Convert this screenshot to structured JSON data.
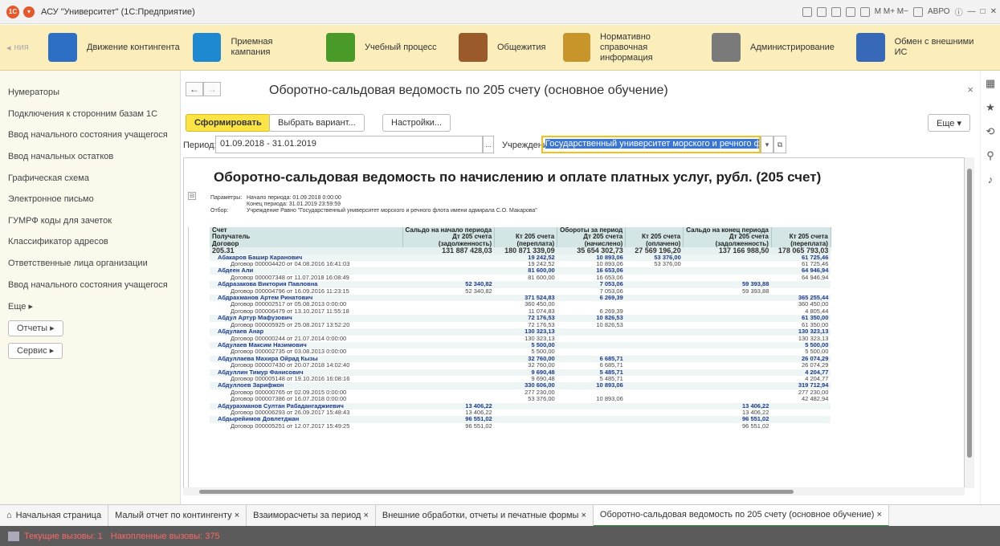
{
  "window": {
    "title": "АСУ \"Университет\" (1С:Предприятие)",
    "user": "АВРО"
  },
  "sections": [
    {
      "label": "ния",
      "color": "#3a6bd0"
    },
    {
      "label": "Движение контингента",
      "color": "#2d6fc4"
    },
    {
      "label": "Приемная кампания",
      "color": "#1e88d0"
    },
    {
      "label": "Учебный процесс",
      "color": "#4a9a2a"
    },
    {
      "label": "Общежития",
      "color": "#9b5a2a"
    },
    {
      "label": "Нормативно справочная информация",
      "color": "#c8952a"
    },
    {
      "label": "Администрирование",
      "color": "#7a7a7a"
    },
    {
      "label": "Обмен с внешними ИС",
      "color": "#3868b8"
    }
  ],
  "sidebar": {
    "items": [
      "Нумераторы",
      "Подключения к сторонним базам 1С",
      "Ввод начального состояния учащегося",
      "Ввод начальных остатков",
      "Графическая схема",
      "Электронное письмо",
      "ГУМРФ коды для зачеток",
      "Классификатор адресов",
      "Ответственные лица организации",
      "Ввод начального состояния учащегося",
      "Еще ▸"
    ],
    "reports_btn": "Отчеты ▸",
    "service_btn": "Сервис ▸"
  },
  "form": {
    "title": "Оборотно-сальдовая ведомость по 205 счету (основное обучение)",
    "btn_generate": "Сформировать",
    "btn_variant": "Выбрать вариант...",
    "btn_settings": "Настройки...",
    "btn_more": "Еще ▾",
    "period_label": "Период:",
    "period_value": "01.09.2018 - 31.01.2019",
    "org_label": "Учреждение:",
    "org_value": "Государственный университет морского и речного флота им"
  },
  "report": {
    "title": "Оборотно-сальдовая ведомость по начислению и оплате платных услуг, рубл. (205 счет)",
    "params_label": "Параметры:",
    "param1": "Начало периода: 01.09.2018 0:00:00",
    "param2": "Конец периода: 31.01.2019 23:59:59",
    "filter_label": "Отбор:",
    "filter_value": "Учреждение Равно \"Государственный университет морского и речного флота имени адмирала С.О. Макарова\"",
    "headers": [
      [
        "Счет",
        "Сальдо на начало периода",
        "",
        "Обороты за период",
        "",
        "Сальдо на конец периода",
        ""
      ],
      [
        "Получатель",
        "Дт 205 счета",
        "Кт 205 счета",
        "Дт 205 счета",
        "Кт 205 счета",
        "Дт 205 счета",
        "Кт 205 счета"
      ],
      [
        "Договор",
        "(задолженность)",
        "(переплата)",
        "(начислено)",
        "(оплачено)",
        "(задолженность)",
        "(переплата)"
      ]
    ],
    "total": [
      "205.31",
      "131 887 428,03",
      "180 871 339,09",
      "35 654 302,73",
      "27 569 196,20",
      "137 166 988,50",
      "178 065 793,03"
    ],
    "rows": [
      [
        "p",
        "Абакаров Башир Каранович",
        "",
        "19 242,52",
        "10 893,06",
        "53 376,00",
        "",
        "61 725,46"
      ],
      [
        "d",
        "Договор 000004420 от 04.08.2016 16:41:03",
        "",
        "19 242,52",
        "10 893,06",
        "53 376,00",
        "",
        "61 725,46"
      ],
      [
        "p",
        "Абдеен Али",
        "",
        "81 600,00",
        "16 653,06",
        "",
        "",
        "64 946,94"
      ],
      [
        "d",
        "Договор 000007348 от 11.07.2018 16:08:49",
        "",
        "81 600,00",
        "16 653,06",
        "",
        "",
        "64 946,94"
      ],
      [
        "p",
        "Абдразакова Виктория Павловна",
        "52 340,82",
        "",
        "7 053,06",
        "",
        "59 393,88",
        ""
      ],
      [
        "d",
        "Договор 000004796 от 16.09.2016 11:23:15",
        "52 340,82",
        "",
        "7 053,06",
        "",
        "59 393,88",
        ""
      ],
      [
        "p",
        "Абдрахманов Артем Ринатович",
        "",
        "371 524,83",
        "6 269,39",
        "",
        "",
        "365 255,44"
      ],
      [
        "d",
        "Договор 000002517 от 05.08.2013 0:00:00",
        "",
        "360 450,00",
        "",
        "",
        "",
        "360 450,00"
      ],
      [
        "d",
        "Договор 000006479 от 13.10.2017 11:55:18",
        "",
        "11 074,83",
        "6 269,39",
        "",
        "",
        "4 805,44"
      ],
      [
        "p",
        "Абдул Артур Мафузович",
        "",
        "72 176,53",
        "10 826,53",
        "",
        "",
        "61 350,00"
      ],
      [
        "d",
        "Договор 000005925 от 25.08.2017 13:52:20",
        "",
        "72 176,53",
        "10 826,53",
        "",
        "",
        "61 350,00"
      ],
      [
        "p",
        "Абдулаев Анар",
        "",
        "130 323,13",
        "",
        "",
        "",
        "130 323,13"
      ],
      [
        "d",
        "Договор 000000244 от 21.07.2014 0:00:00",
        "",
        "130 323,13",
        "",
        "",
        "",
        "130 323,13"
      ],
      [
        "p",
        "Абдулаев Максим Назимович",
        "",
        "5 500,00",
        "",
        "",
        "",
        "5 500,00"
      ],
      [
        "d",
        "Договор 000002735 от 03.08.2013 0:00:00",
        "",
        "5 500,00",
        "",
        "",
        "",
        "5 500,00"
      ],
      [
        "p",
        "Абдуллаева Махира Ойрад Кызы",
        "",
        "32 760,00",
        "6 685,71",
        "",
        "",
        "26 074,29"
      ],
      [
        "d",
        "Договор 000007430 от 20.07.2018 14:02:40",
        "",
        "32 760,00",
        "6 685,71",
        "",
        "",
        "26 074,29"
      ],
      [
        "p",
        "Абдуллин Тимур Фанисович",
        "",
        "9 690,48",
        "5 485,71",
        "",
        "",
        "4 204,77"
      ],
      [
        "d",
        "Договор 000005148 от 19.10.2016 16:08:16",
        "",
        "9 690,48",
        "5 485,71",
        "",
        "",
        "4 204,77"
      ],
      [
        "p",
        "Абдуллоев Зарифжон",
        "",
        "330 606,00",
        "10 893,06",
        "",
        "",
        "319 712,94"
      ],
      [
        "d",
        "Договор 000000765 от 02.09.2015 0:00:00",
        "",
        "277 230,00",
        "",
        "",
        "",
        "277 230,00"
      ],
      [
        "d",
        "Договор 000007386 от 16.07.2018 0:00:00",
        "",
        "53 376,00",
        "10 893,06",
        "",
        "",
        "42 482,94"
      ],
      [
        "p",
        "Абдурахманов Султан Рабадангаджиевич",
        "13 406,22",
        "",
        "",
        "",
        "13 406,22",
        ""
      ],
      [
        "d",
        "Договор 000006293 от 26.09.2017 15:48:43",
        "13 406,22",
        "",
        "",
        "",
        "13 406,22",
        ""
      ],
      [
        "p",
        "Абдырейимов Довлетджан",
        "96 551,02",
        "",
        "",
        "",
        "96 551,02",
        ""
      ],
      [
        "d",
        "Договор 000005251 от 12.07.2017 15:49:25",
        "96 551,02",
        "",
        "",
        "",
        "96 551,02",
        ""
      ]
    ]
  },
  "tabs": [
    "Начальная страница",
    "Малый отчет по контингенту ×",
    "Взаиморасчеты за период ×",
    "Внешние обработки, отчеты и печатные формы ×",
    "Оборотно-сальдовая ведомость по 205 счету (основное обучение) ×"
  ],
  "status": {
    "current_calls": "Текущие вызовы: 1",
    "accumulated_calls": "Накопленные вызовы: 375"
  }
}
